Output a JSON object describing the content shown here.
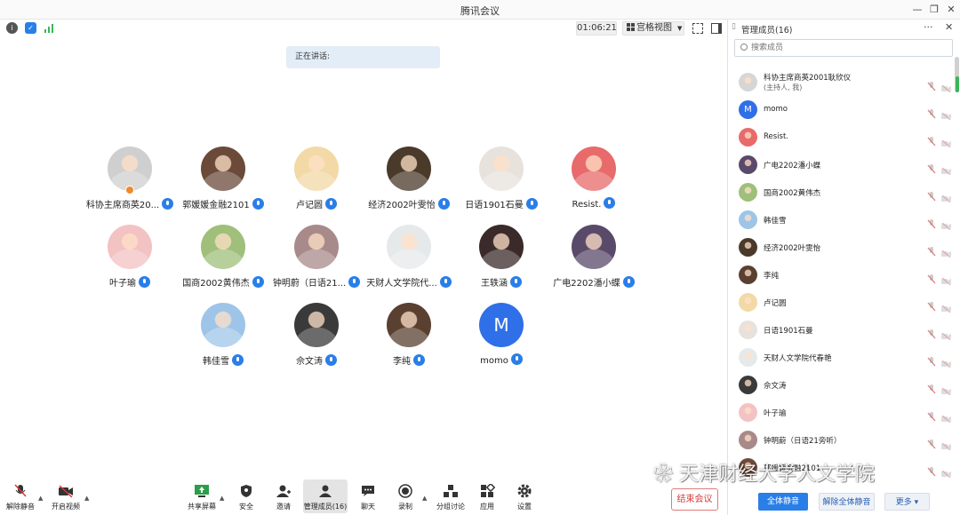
{
  "window": {
    "title": "腾讯会议"
  },
  "toolbar": {
    "timer": "01:06:21",
    "grid_view_label": "宫格视图"
  },
  "speaking_banner": "正在讲话:",
  "participants": [
    {
      "name": "科协主席商英20...",
      "avatar_color": "#cfcfcf"
    },
    {
      "name": "郭媛媛金融2101",
      "avatar_color": "#6b4a3a"
    },
    {
      "name": "卢记圆",
      "avatar_color": "#f2d9a6"
    },
    {
      "name": "经济2002叶雯怡",
      "avatar_color": "#4a3a2a"
    },
    {
      "name": "日语1901石曼",
      "avatar_color": "#e7e2dc"
    },
    {
      "name": "Resist.",
      "avatar_color": "#e86a6a"
    },
    {
      "name": "叶子瑜",
      "avatar_color": "#f3c2c2"
    },
    {
      "name": "国商2002黄伟杰",
      "avatar_color": "#9fbf7a"
    },
    {
      "name": "钟明蔚（日语21...",
      "avatar_color": "#a98a8a"
    },
    {
      "name": "天财人文学院代...",
      "avatar_color": "#e6e9ea"
    },
    {
      "name": "王轶涵",
      "avatar_color": "#3a2a2a"
    },
    {
      "name": "广电2202潘小蝶",
      "avatar_color": "#5a4a6a"
    },
    {
      "name": "韩佳雪",
      "avatar_color": "#9ec5e8"
    },
    {
      "name": "佘文涛",
      "avatar_color": "#3a3a3a"
    },
    {
      "name": "李纯",
      "avatar_color": "#5a4030"
    },
    {
      "name": "momo",
      "avatar_color": "#2f6fe8",
      "initial": "M"
    }
  ],
  "panel": {
    "title": "管理成员(16)",
    "search_placeholder": "搜索成员",
    "members": [
      {
        "name": "科协主席商英2001耿欣仪",
        "sub": "(主持人, 我)",
        "avatar_color": "#d6d6d6"
      },
      {
        "name": "momo",
        "avatar_color": "#2f6fe8",
        "initial": "M"
      },
      {
        "name": "Resist.",
        "avatar_color": "#e86a6a"
      },
      {
        "name": "广电2202潘小蝶",
        "avatar_color": "#5a4a6a"
      },
      {
        "name": "国商2002黄伟杰",
        "avatar_color": "#9fbf7a"
      },
      {
        "name": "韩佳雪",
        "avatar_color": "#9ec5e8"
      },
      {
        "name": "经济2002叶雯怡",
        "avatar_color": "#4a3a2a"
      },
      {
        "name": "李纯",
        "avatar_color": "#5a4030"
      },
      {
        "name": "卢记圆",
        "avatar_color": "#f2d9a6"
      },
      {
        "name": "日语1901石曼",
        "avatar_color": "#e7e2dc"
      },
      {
        "name": "天财人文学院代春艳",
        "avatar_color": "#e6e9ea"
      },
      {
        "name": "佘文涛",
        "avatar_color": "#3a3a3a"
      },
      {
        "name": "叶子瑜",
        "avatar_color": "#f3c2c2"
      },
      {
        "name": "钟明蔚（日语21旁听）",
        "avatar_color": "#a98a8a"
      },
      {
        "name": "郭媛媛金融2101",
        "avatar_color": "#6b4a3a"
      }
    ],
    "mute_all": "全体静音",
    "unmute_all": "解除全体静音",
    "more": "更多"
  },
  "bottom": {
    "unmute": "解除静音",
    "start_video": "开启视频",
    "share_screen": "共享屏幕",
    "security": "安全",
    "invite": "邀请",
    "manage_members": "管理成员(16)",
    "chat": "聊天",
    "record": "录制",
    "breakout": "分组讨论",
    "apps": "应用",
    "settings": "设置",
    "end_meeting": "结束会议"
  },
  "watermark": "天津财经大学人文学院",
  "colors": {
    "accent": "#2a7ee8",
    "end": "#d63b3b",
    "banner": "#e3edf8"
  }
}
